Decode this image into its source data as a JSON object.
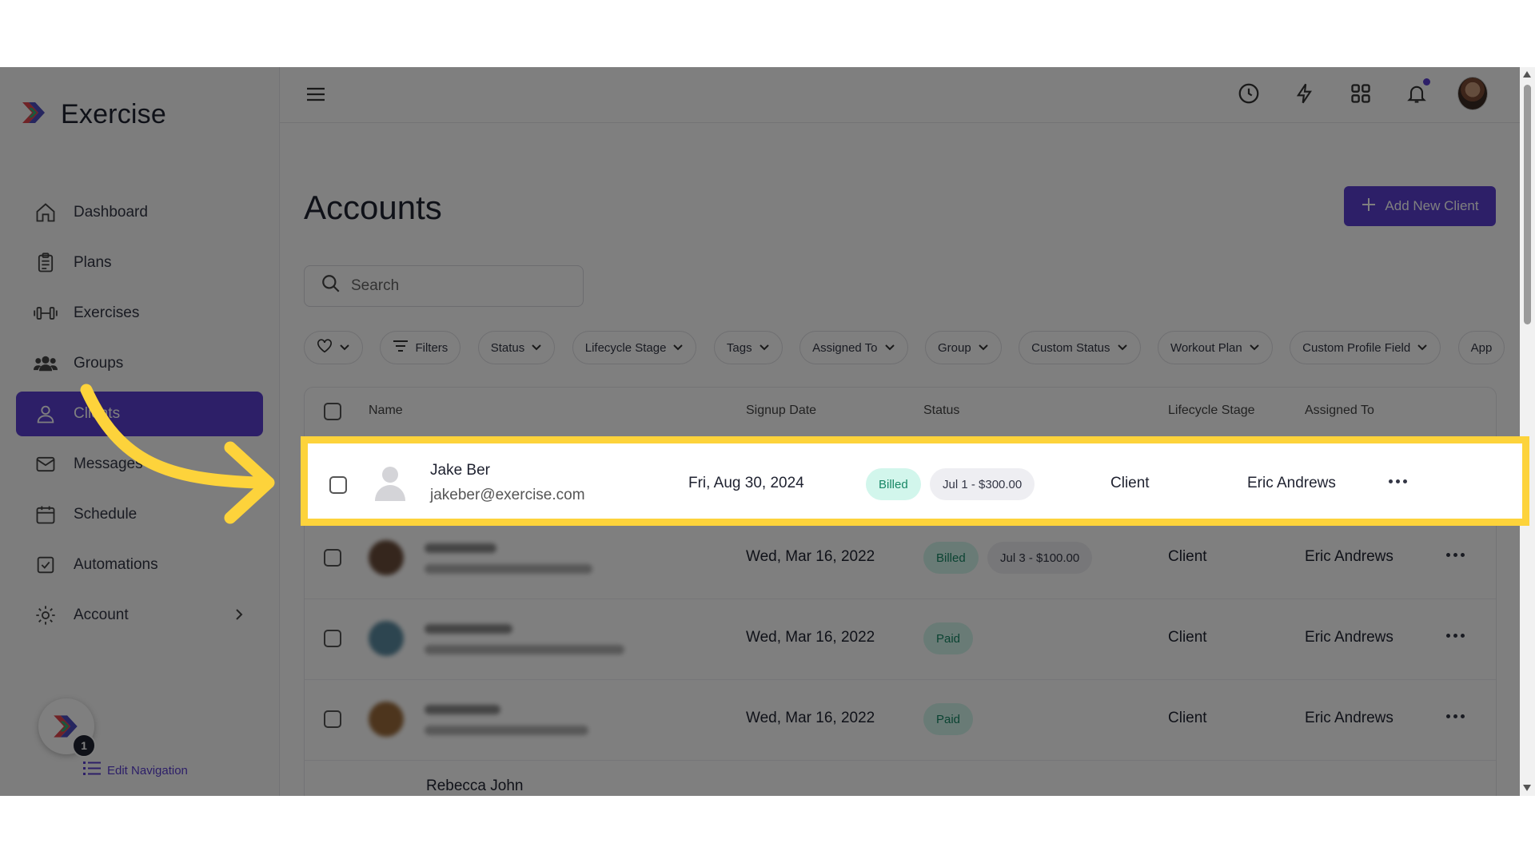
{
  "app": {
    "name": "Exercise"
  },
  "sidebar": {
    "items": [
      {
        "label": "Dashboard",
        "icon": "home-icon"
      },
      {
        "label": "Plans",
        "icon": "clipboard-icon"
      },
      {
        "label": "Exercises",
        "icon": "dumbbell-icon"
      },
      {
        "label": "Groups",
        "icon": "users-icon"
      },
      {
        "label": "Clients",
        "icon": "user-icon",
        "active": true
      },
      {
        "label": "Messages",
        "icon": "mail-icon"
      },
      {
        "label": "Schedule",
        "icon": "calendar-icon"
      },
      {
        "label": "Automations",
        "icon": "checkbox-icon"
      },
      {
        "label": "Account",
        "icon": "gear-icon"
      }
    ],
    "edit_navigation": "Edit Navigation",
    "badge_count": "1"
  },
  "topbar": {
    "icons": [
      "menu-icon",
      "clock-icon",
      "bolt-icon",
      "grid-icon",
      "bell-icon",
      "avatar"
    ]
  },
  "main": {
    "title": "Accounts",
    "add_button": "Add New Client",
    "search_placeholder": "Search",
    "filters": [
      "Filters",
      "Status",
      "Lifecycle Stage",
      "Tags",
      "Assigned To",
      "Group",
      "Custom Status",
      "Workout Plan",
      "Custom Profile Field",
      "App"
    ]
  },
  "table": {
    "headers": {
      "name": "Name",
      "signup": "Signup Date",
      "status": "Status",
      "lifecycle": "Lifecycle Stage",
      "assigned": "Assigned To"
    },
    "rows": [
      {
        "name": "Jake Ber",
        "email": "jakeber@exercise.com",
        "signup": "Fri, Aug 30, 2024",
        "status": "Billed",
        "invoice": "Jul 1 - $300.00",
        "lifecycle": "Client",
        "assigned": "Eric Andrews"
      },
      {
        "signup": "Wed, Mar 16, 2022",
        "status": "Billed",
        "invoice": "Jul 3 - $100.00",
        "lifecycle": "Client",
        "assigned": "Eric Andrews"
      },
      {
        "signup": "Wed, Mar 16, 2022",
        "status": "Paid",
        "lifecycle": "Client",
        "assigned": "Eric Andrews"
      },
      {
        "signup": "Wed, Mar 16, 2022",
        "status": "Paid",
        "lifecycle": "Client",
        "assigned": "Eric Andrews"
      },
      {
        "name": "Rebecca John"
      }
    ]
  },
  "colors": {
    "accent": "#5a3fd1",
    "highlight": "#fdd33b",
    "billed_bg": "#d2f6ec"
  }
}
